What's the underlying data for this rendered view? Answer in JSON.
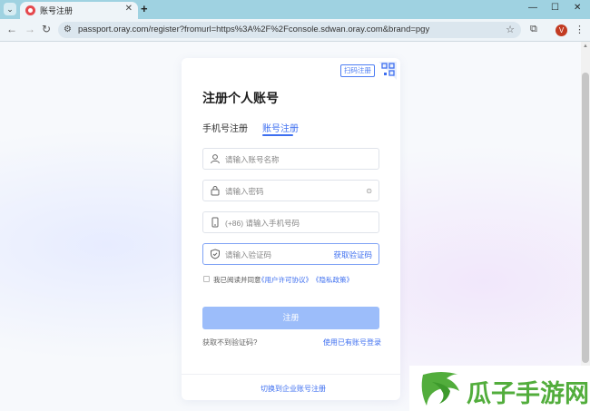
{
  "browser": {
    "tab_title": "账号注册",
    "tab_close": "✕",
    "new_tab": "+",
    "url": "passport.oray.com/register?fromurl=https%3A%2F%2Fconsole.sdwan.oray.com&brand=pgy",
    "avatar_letter": "V",
    "win_minimize": "—",
    "win_maximize": "☐",
    "win_close": "✕"
  },
  "form": {
    "qr_label": "扫码注册",
    "title": "注册个人账号",
    "tabs": [
      {
        "label": "手机号注册",
        "active": false
      },
      {
        "label": "账号注册",
        "active": true
      }
    ],
    "account_placeholder": "请输入账号名称",
    "password_placeholder": "请输入密码",
    "phone_placeholder": "(+86) 请输入手机号码",
    "code_placeholder": "请输入验证码",
    "get_code": "获取验证码",
    "agree_text": "我已阅读并同意",
    "agree_link_license": "《用户许可协议》",
    "agree_link_privacy": "《隐私政策》",
    "submit_label": "注册",
    "no_code_link": "获取不到验证码?",
    "existing_account_link": "使用已有账号登录",
    "enterprise_link": "切换到企业账号注册"
  },
  "watermark": {
    "text": "瓜子手游网"
  },
  "colors": {
    "accent": "#3e6ff0",
    "submit_disabled": "#9cbdfa",
    "watermark_green": "#52ad3c"
  }
}
